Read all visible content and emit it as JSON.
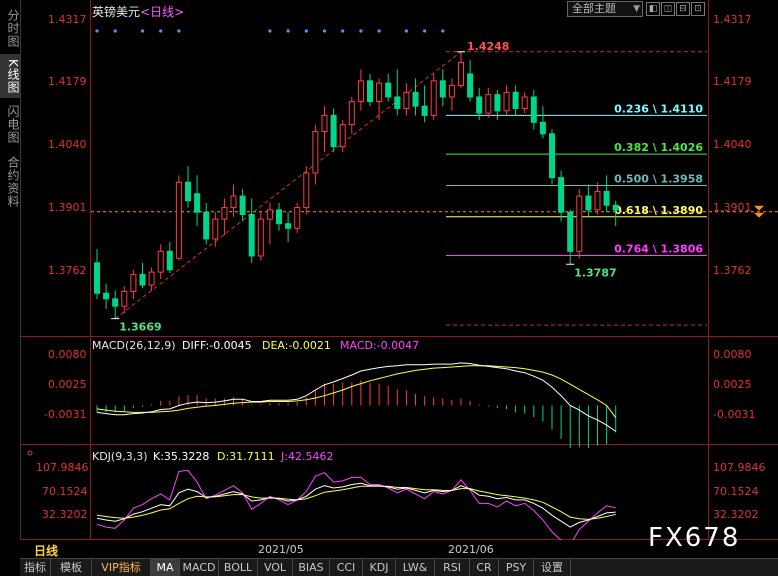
{
  "side_tabs": [
    "分时图",
    "K线图",
    "闪电图",
    "合约资料"
  ],
  "active_side_tab": 1,
  "header": {
    "symbol": "英镑美元",
    "period": "<日线>",
    "theme_select": "全部主题",
    "toolbar_buttons": [
      "◧",
      "◫",
      "⊟",
      "⊡"
    ]
  },
  "colors": {
    "up": "#ff3c3c",
    "down": "#00d68a",
    "grid_red": "#8b1a1a",
    "label_red": "#e03030",
    "fib_cyan": "#7ff9ff",
    "fib_green": "#4fe24f",
    "fib_gray": "#6fb9b9",
    "fib_yellow": "#ffff66",
    "fib_magenta": "#ff3cff",
    "macd_diff": "#ffffff",
    "macd_dea": "#ffff40",
    "macd_macd": "#ff40ff",
    "kdj_k": "#ffffff",
    "kdj_d": "#ffff40",
    "kdj_j": "#ff40ff"
  },
  "chart_data": [
    {
      "type": "candlestick",
      "title": "英镑美元<日线>",
      "price_axis_labels": [
        "1.4317",
        "1.4179",
        "1.4040",
        "1.3901",
        "1.3762"
      ],
      "ylim": [
        1.364,
        1.4317
      ],
      "current_price_label": "1.3901",
      "high_marker": "1.4248",
      "low_marker_left": "1.3669",
      "low_marker_right": "1.3787",
      "fibonacci": [
        {
          "label": "0.236 \\ 1.4110",
          "value": 1.411,
          "color": "fib_cyan"
        },
        {
          "label": "0.382 \\ 1.4026",
          "value": 1.4026,
          "color": "fib_green"
        },
        {
          "label": "0.500 \\ 1.3958",
          "value": 1.3958,
          "color": "fib_gray"
        },
        {
          "label": "0.618 \\ 1.3890",
          "value": 1.389,
          "color": "fib_yellow"
        },
        {
          "label": "0.764 \\ 1.3806",
          "value": 1.3806,
          "color": "fib_magenta"
        }
      ],
      "fib_top": 1.4248,
      "fib_bottom": 1.3655,
      "candles": [
        [
          1.379,
          1.382,
          1.3712,
          1.3724
        ],
        [
          1.3724,
          1.3745,
          1.369,
          1.3712
        ],
        [
          1.3712,
          1.373,
          1.3669,
          1.3696
        ],
        [
          1.3696,
          1.374,
          1.368,
          1.3728
        ],
        [
          1.3728,
          1.3775,
          1.3712,
          1.3765
        ],
        [
          1.3765,
          1.379,
          1.3735,
          1.3742
        ],
        [
          1.3742,
          1.378,
          1.373,
          1.377
        ],
        [
          1.377,
          1.383,
          1.3755,
          1.3815
        ],
        [
          1.3815,
          1.3835,
          1.3768,
          1.3775
        ],
        [
          1.38,
          1.398,
          1.3795,
          1.3965
        ],
        [
          1.3965,
          1.4,
          1.391,
          1.3925
        ],
        [
          1.394,
          1.398,
          1.387,
          1.39
        ],
        [
          1.39,
          1.392,
          1.383,
          1.3842
        ],
        [
          1.3842,
          1.39,
          1.3825,
          1.3885
        ],
        [
          1.3885,
          1.393,
          1.385,
          1.391
        ],
        [
          1.391,
          1.396,
          1.389,
          1.3935
        ],
        [
          1.3935,
          1.395,
          1.388,
          1.3895
        ],
        [
          1.3895,
          1.393,
          1.379,
          1.3805
        ],
        [
          1.3805,
          1.39,
          1.3795,
          1.3885
        ],
        [
          1.3885,
          1.392,
          1.383,
          1.3905
        ],
        [
          1.3905,
          1.392,
          1.386,
          1.3875
        ],
        [
          1.3875,
          1.39,
          1.3835,
          1.3865
        ],
        [
          1.3865,
          1.392,
          1.3855,
          1.391
        ],
        [
          1.391,
          1.4,
          1.3895,
          1.3985
        ],
        [
          1.3985,
          1.409,
          1.396,
          1.4075
        ],
        [
          1.4075,
          1.413,
          1.403,
          1.411
        ],
        [
          1.411,
          1.4125,
          1.403,
          1.4042
        ],
        [
          1.4042,
          1.41,
          1.403,
          1.409
        ],
        [
          1.409,
          1.415,
          1.407,
          1.414
        ],
        [
          1.414,
          1.421,
          1.412,
          1.4185
        ],
        [
          1.4185,
          1.42,
          1.413,
          1.414
        ],
        [
          1.414,
          1.419,
          1.41,
          1.418
        ],
        [
          1.418,
          1.42,
          1.414,
          1.415
        ],
        [
          1.415,
          1.421,
          1.411,
          1.4125
        ],
        [
          1.4125,
          1.418,
          1.411,
          1.416
        ],
        [
          1.416,
          1.419,
          1.411,
          1.413
        ],
        [
          1.413,
          1.4175,
          1.4095,
          1.411
        ],
        [
          1.411,
          1.42,
          1.41,
          1.4185
        ],
        [
          1.4185,
          1.421,
          1.413,
          1.415
        ],
        [
          1.415,
          1.419,
          1.412,
          1.4175
        ],
        [
          1.4175,
          1.4248,
          1.417,
          1.4225
        ],
        [
          1.42,
          1.423,
          1.414,
          1.415
        ],
        [
          1.415,
          1.417,
          1.41,
          1.4115
        ],
        [
          1.4115,
          1.417,
          1.4105,
          1.4155
        ],
        [
          1.4155,
          1.4165,
          1.41,
          1.412
        ],
        [
          1.412,
          1.4175,
          1.411,
          1.416
        ],
        [
          1.416,
          1.4175,
          1.411,
          1.4125
        ],
        [
          1.4125,
          1.416,
          1.4115,
          1.415
        ],
        [
          1.415,
          1.4165,
          1.408,
          1.4095
        ],
        [
          1.4095,
          1.413,
          1.406,
          1.407
        ],
        [
          1.407,
          1.408,
          1.396,
          1.3975
        ],
        [
          1.3975,
          1.399,
          1.388,
          1.39
        ],
        [
          1.39,
          1.3905,
          1.3787,
          1.3815
        ],
        [
          1.3815,
          1.395,
          1.38,
          1.3935
        ],
        [
          1.3935,
          1.396,
          1.389,
          1.3905
        ],
        [
          1.3905,
          1.3965,
          1.3895,
          1.3945
        ],
        [
          1.3945,
          1.398,
          1.39,
          1.3915
        ],
        [
          1.3915,
          1.3925,
          1.387,
          1.3905
        ]
      ]
    },
    {
      "type": "macd",
      "title": "MACD(26,12,9)",
      "values_text": {
        "diff": "DIFF:-0.0045",
        "dea": "DEA:-0.0021",
        "macd": "MACD:-0.0047"
      },
      "axis_labels": [
        "0.0080",
        "0.0025",
        "-0.0031"
      ],
      "ylim": [
        -0.006,
        0.01
      ],
      "diff": [
        -0.0012,
        -0.0014,
        -0.0016,
        -0.0016,
        -0.0014,
        -0.0013,
        -0.0011,
        -0.0007,
        -0.0006,
        0.0,
        0.0004,
        0.0006,
        0.0005,
        0.0006,
        0.0008,
        0.0011,
        0.0011,
        0.0007,
        0.0007,
        0.0009,
        0.0009,
        0.0009,
        0.0011,
        0.0017,
        0.0027,
        0.0036,
        0.0041,
        0.0047,
        0.0053,
        0.006,
        0.0063,
        0.0066,
        0.0068,
        0.0069,
        0.0071,
        0.0071,
        0.0071,
        0.0072,
        0.0072,
        0.0072,
        0.0074,
        0.0073,
        0.007,
        0.0068,
        0.0066,
        0.0064,
        0.006,
        0.0057,
        0.0051,
        0.0044,
        0.0032,
        0.0017,
        0.0,
        -0.0008,
        -0.0018,
        -0.0025,
        -0.0034,
        -0.0045
      ],
      "dea": [
        -0.0006,
        -0.0008,
        -0.001,
        -0.0011,
        -0.0012,
        -0.0012,
        -0.0012,
        -0.0011,
        -0.001,
        -0.0008,
        -0.0005,
        -0.0003,
        -0.0001,
        0.0,
        0.0002,
        0.0004,
        0.0005,
        0.0006,
        0.0006,
        0.0007,
        0.0007,
        0.0007,
        0.0008,
        0.001,
        0.0013,
        0.0017,
        0.0022,
        0.0027,
        0.0033,
        0.0038,
        0.0043,
        0.0047,
        0.0051,
        0.0055,
        0.0058,
        0.0061,
        0.0063,
        0.0065,
        0.0066,
        0.0067,
        0.0068,
        0.0069,
        0.0069,
        0.0069,
        0.0068,
        0.0067,
        0.0066,
        0.0064,
        0.0061,
        0.0058,
        0.0053,
        0.0046,
        0.0037,
        0.0028,
        0.0019,
        0.001,
        0.0,
        -0.0021
      ],
      "macd": [
        -0.0012,
        -0.0012,
        -0.0012,
        -0.001,
        -0.0004,
        -0.0002,
        0.0002,
        0.0008,
        0.0008,
        0.0016,
        0.0018,
        0.0018,
        0.0012,
        0.0012,
        0.0012,
        0.0014,
        0.0012,
        0.0002,
        0.0002,
        0.0004,
        0.0004,
        0.0004,
        0.0006,
        0.0014,
        0.0028,
        0.0038,
        0.0038,
        0.004,
        0.004,
        0.0044,
        0.004,
        0.0038,
        0.0034,
        0.0028,
        0.0026,
        0.002,
        0.0016,
        0.0014,
        0.0012,
        0.001,
        0.0012,
        0.0008,
        0.0002,
        -0.0002,
        -0.0004,
        -0.0006,
        -0.0012,
        -0.0014,
        -0.002,
        -0.0028,
        -0.0042,
        -0.0058,
        -0.0074,
        -0.0072,
        -0.0074,
        -0.007,
        -0.0068,
        -0.0047
      ]
    },
    {
      "type": "kdj",
      "title": "KDJ(9,3,3)",
      "values_text": {
        "k": "K:35.3228",
        "d": "D:31.7111",
        "j": "J:42.5462"
      },
      "axis_labels": [
        "107.9846",
        "70.1524",
        "32.3202"
      ],
      "ylim": [
        -5,
        120
      ],
      "k": [
        25,
        22,
        20,
        24,
        32,
        36,
        42,
        48,
        46,
        68,
        74,
        70,
        60,
        62,
        66,
        70,
        66,
        54,
        56,
        60,
        58,
        54,
        56,
        62,
        74,
        80,
        76,
        78,
        82,
        84,
        80,
        80,
        78,
        74,
        76,
        72,
        68,
        72,
        70,
        72,
        80,
        74,
        64,
        62,
        58,
        60,
        56,
        56,
        50,
        42,
        30,
        20,
        10,
        18,
        22,
        28,
        34,
        35.3228
      ],
      "d": [
        30,
        28,
        26,
        25,
        27,
        30,
        34,
        39,
        41,
        50,
        58,
        62,
        61,
        61,
        63,
        65,
        65,
        61,
        59,
        59,
        59,
        57,
        56,
        58,
        63,
        69,
        71,
        73,
        76,
        79,
        79,
        79,
        79,
        77,
        77,
        75,
        73,
        73,
        72,
        72,
        75,
        75,
        71,
        68,
        65,
        63,
        61,
        59,
        56,
        52,
        44,
        36,
        27,
        24,
        23,
        25,
        28,
        31.7111
      ],
      "j": [
        15,
        10,
        8,
        22,
        42,
        48,
        58,
        66,
        56,
        104,
        106,
        86,
        58,
        64,
        72,
        80,
        68,
        40,
        50,
        62,
        56,
        48,
        56,
        70,
        96,
        102,
        86,
        88,
        94,
        94,
        82,
        82,
        76,
        68,
        74,
        66,
        58,
        70,
        66,
        72,
        90,
        72,
        50,
        50,
        44,
        54,
        46,
        50,
        38,
        22,
        2,
        -12,
        -20,
        6,
        20,
        34,
        46,
        42.5462
      ]
    }
  ],
  "period_bar": {
    "label": "日线",
    "dates": [
      "2021/05",
      "2021/06"
    ]
  },
  "tabs": [
    "指标",
    "模板",
    "VIP指标",
    "MA",
    "MACD",
    "BOLL",
    "VOL",
    "BIAS",
    "CCI",
    "KDJ",
    "LW&",
    "RSI",
    "CR",
    "PSY",
    "设置"
  ],
  "active_tab": "MA",
  "watermark": "FX678"
}
